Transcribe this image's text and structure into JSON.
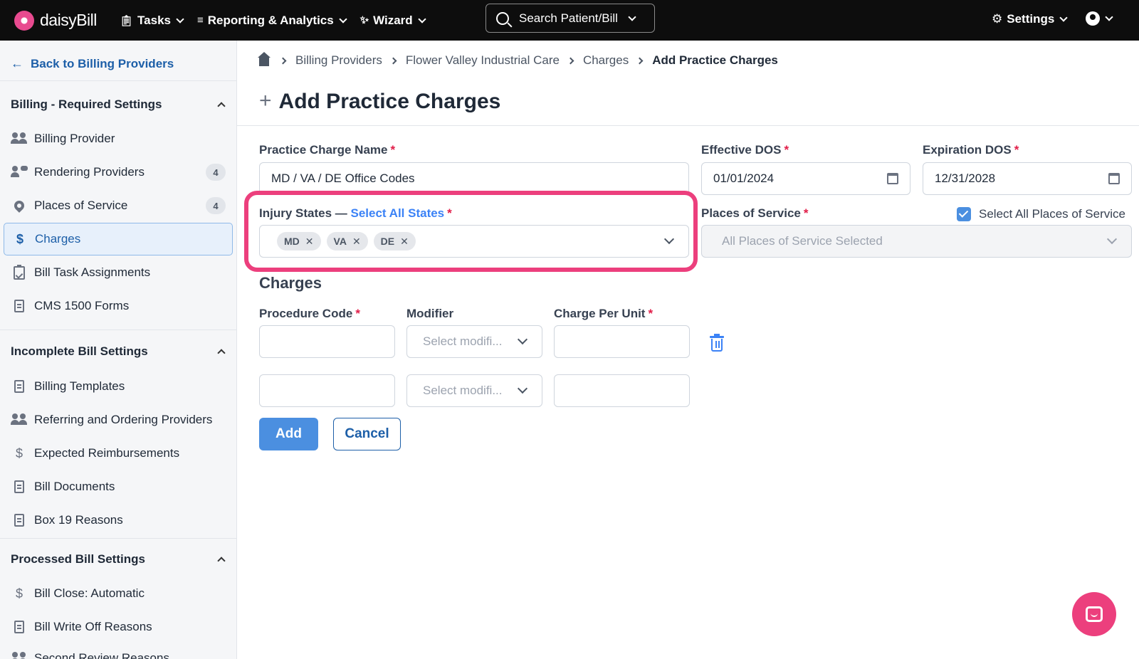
{
  "topbar": {
    "brand": "daisyBill",
    "nav": [
      {
        "label": "Tasks",
        "icon": "clipboard-icon"
      },
      {
        "label": "Reporting & Analytics",
        "icon": "bar-chart-icon"
      },
      {
        "label": "Wizard",
        "icon": "magic-wand-icon"
      }
    ],
    "search_label": "Search Patient/Bill",
    "settings_label": "Settings"
  },
  "sidebar": {
    "back_label": "Back to Billing Providers",
    "sections": [
      {
        "title": "Billing - Required Settings",
        "items": [
          {
            "label": "Billing Provider",
            "icon": "people-icon"
          },
          {
            "label": "Rendering Providers",
            "icon": "user-chat-icon",
            "badge": "4"
          },
          {
            "label": "Places of Service",
            "icon": "map-pin-icon",
            "badge": "4"
          },
          {
            "label": "Charges",
            "icon": "dollar-icon",
            "active": true
          },
          {
            "label": "Bill Task Assignments",
            "icon": "clipboard-check-icon"
          },
          {
            "label": "CMS 1500 Forms",
            "icon": "document-icon"
          }
        ]
      },
      {
        "title": "Incomplete Bill Settings",
        "items": [
          {
            "label": "Billing Templates",
            "icon": "document-icon"
          },
          {
            "label": "Referring and Ordering Providers",
            "icon": "people-icon"
          },
          {
            "label": "Expected Reimbursements",
            "icon": "dollar-icon"
          },
          {
            "label": "Bill Documents",
            "icon": "document-icon"
          },
          {
            "label": "Box 19 Reasons",
            "icon": "document-icon"
          }
        ]
      },
      {
        "title": "Processed Bill Settings",
        "items": [
          {
            "label": "Bill Close: Automatic",
            "icon": "dollar-icon"
          },
          {
            "label": "Bill Write Off Reasons",
            "icon": "document-icon"
          },
          {
            "label": "Second Review Reasons",
            "icon": "people-icon"
          }
        ]
      }
    ]
  },
  "breadcrumb": [
    "Billing Providers",
    "Flower Valley Industrial Care",
    "Charges",
    "Add Practice Charges"
  ],
  "page_title": "Add Practice Charges",
  "form": {
    "charge_name_label": "Practice Charge Name",
    "charge_name_value": "MD / VA / DE Office Codes",
    "effective_label": "Effective DOS",
    "effective_value": "01/01/2024",
    "expiration_label": "Expiration DOS",
    "expiration_value": "12/31/2028",
    "injury_states_label": "Injury States — ",
    "select_all_states": "Select All States",
    "states": [
      "MD",
      "VA",
      "DE"
    ],
    "pos_label": "Places of Service",
    "pos_checkbox_label": "Select All Places of Service",
    "pos_value": "All Places of Service Selected",
    "charges_heading": "Charges",
    "procedure_code_label": "Procedure Code",
    "modifier_label": "Modifier",
    "charge_per_unit_label": "Charge Per Unit",
    "modifier_placeholder": "Select modifi...",
    "add_button": "Add",
    "cancel_button": "Cancel"
  },
  "colors": {
    "accent": "#4b8fe0",
    "link": "#1d5fa8",
    "highlight": "#ec3f7d",
    "required": "#e11d48"
  }
}
